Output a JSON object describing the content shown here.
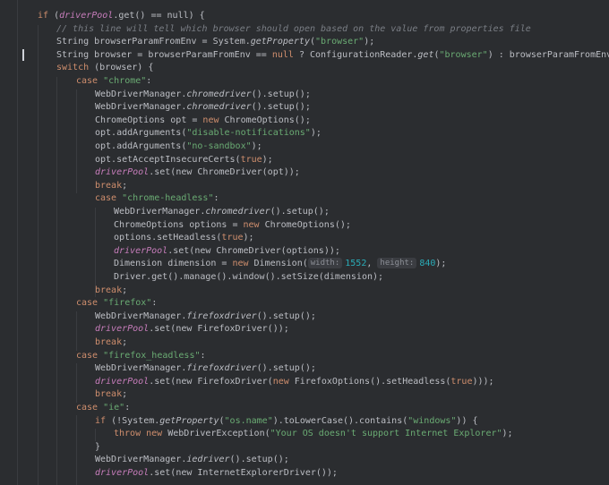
{
  "s": {
    "if": "if",
    "null": "null",
    "new": "new",
    "switch": "switch",
    "case": "case",
    "break": "break",
    "true": "true",
    "throw": "throw",
    "lp": "(",
    "rp": ")",
    "rb": ")) {",
    "call_end": "().setup();",
    "set_new": ".set(new ",
    "driverPool": "driverPool",
    "wdm": "WebDriverManager.",
    "chromedriver": "chromedriver",
    "firefoxdriver": "firefoxdriver",
    "iedriver": "iedriver",
    "brace_close": "}",
    "eq_null_open": ".get() == null) {",
    "semicolon": ";"
  },
  "code": {
    "l2_comment": "// this line will tell which browser should open based on the value from properties file",
    "l3_a": "String browserParamFromEnv = System.",
    "l3_m": "getProperty",
    "l3_str": "\"browser\"",
    "l3_end": ");",
    "l4_a": "String browser = browserParamFromEnv == ",
    "l4_b": " ? ConfigurationReader.",
    "l4_m": "get",
    "l4_str": "\"browser\"",
    "l4_end": ") : browserParamFromEnv;",
    "l5_end": " (browser) {",
    "chrome_str": "\"chrome\"",
    "chrome_headless_str": "\"chrome-headless\"",
    "firefox_str": "\"firefox\"",
    "firefox_headless_str": "\"firefox_headless\"",
    "ie_str": "\"ie\"",
    "colon": ":",
    "l9_a": "ChromeOptions opt = ",
    "l9_b": " ChromeOptions();",
    "l10_a": "opt.addArguments(",
    "l10_str": "\"disable-notifications\"",
    "l11_str": "\"no-sandbox\"",
    "args_end": ");",
    "l12_a": "opt.setAcceptInsecureCerts(",
    "l13_b": "ChromeDriver(opt));",
    "l17_a": "ChromeOptions options = ",
    "l17_b": " ChromeOptions();",
    "l18_a": "options.setHeadless(",
    "l19_b": "ChromeDriver(options));",
    "l20_a": "Dimension dimension = ",
    "l20_b": " Dimension(",
    "hint_width": "width:",
    "num_width": "1552",
    "comma": ", ",
    "hint_height": "height:",
    "num_height": "840",
    "l21": "Driver.get().manage().window().setSize(dimension);",
    "l25_b": "FirefoxDriver());",
    "l29_b": "FirefoxDriver(",
    "l29_c": " FirefoxOptions().setHeadless(",
    "l29_end": ")));",
    "l32_a": " (!System.",
    "l32_str": "\"os.name\"",
    "l32_b": ").toLowerCase().contains(",
    "l32_str2": "\"windows\"",
    "l33_b": " WebDriverException(",
    "l33_str": "\"Your OS doesn't support Internet Explorer\"",
    "l36_b": "InternetExplorerDriver());"
  }
}
